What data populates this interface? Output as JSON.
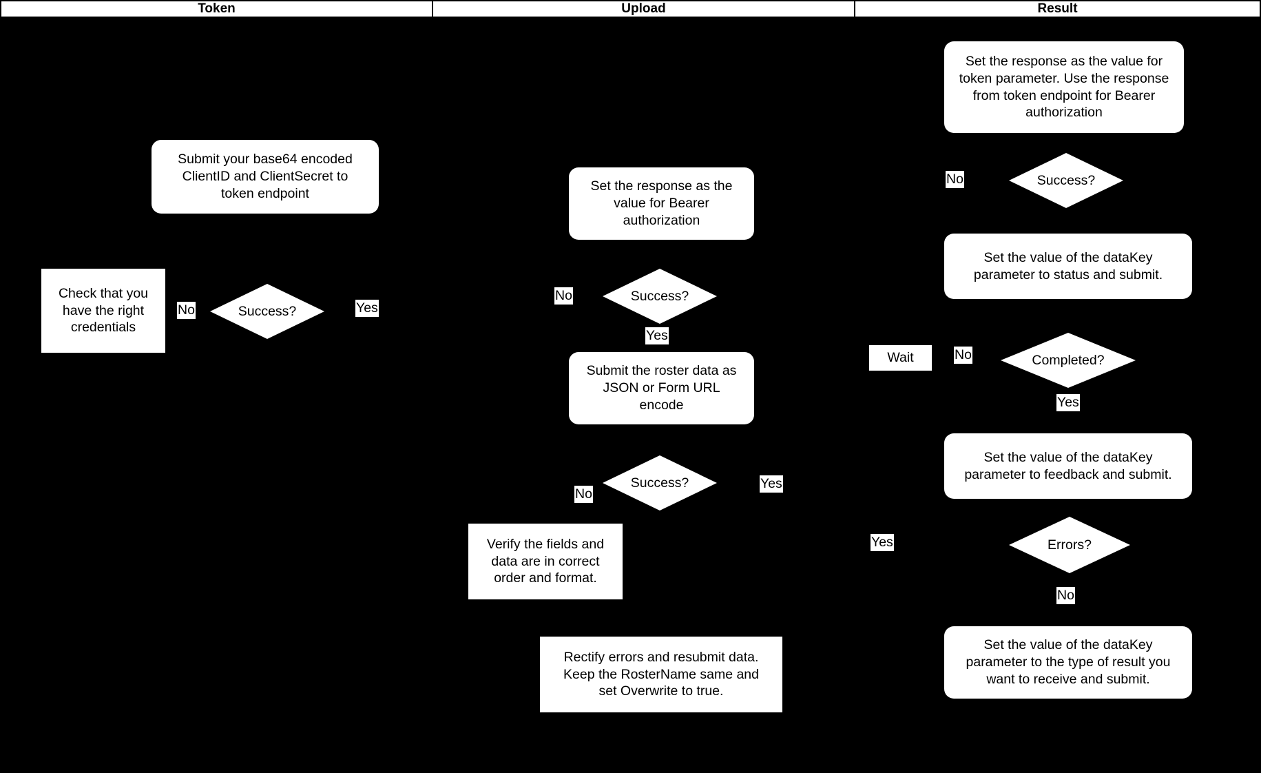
{
  "header": {
    "columns": [
      {
        "label": "Token"
      },
      {
        "label": "Upload"
      },
      {
        "label": "Result"
      }
    ]
  },
  "token_lane": {
    "nodes": [
      {
        "id": "submit-credentials",
        "shape": "rounded-rect",
        "text": "Submit your base64 encoded\nClientID and ClientSecret to\ntoken endpoint"
      },
      {
        "id": "check-credentials",
        "shape": "rect",
        "text": "Check that you\nhave the right\ncredentials"
      }
    ],
    "decisions": [
      {
        "id": "token-success",
        "text": "Success?"
      }
    ],
    "edge_labels": [
      {
        "id": "token-success-no",
        "text": "No"
      },
      {
        "id": "token-success-yes",
        "text": "Yes"
      }
    ]
  },
  "upload_lane": {
    "nodes": [
      {
        "id": "set-bearer-auth",
        "shape": "rounded-rect",
        "text": "Set the response as the\nvalue for Bearer\nauthorization"
      },
      {
        "id": "submit-roster-data",
        "shape": "rounded-rect",
        "text": "Submit the roster data as\nJSON or Form URL\nencode"
      },
      {
        "id": "verify-fields",
        "shape": "rect",
        "text": "Verify the fields and\ndata are in correct\norder and format."
      },
      {
        "id": "rectify-errors",
        "shape": "rect",
        "text": "Rectify errors and resubmit data.\nKeep the RosterName same and\nset Overwrite to true."
      }
    ],
    "decisions": [
      {
        "id": "upload-auth-success",
        "text": "Success?"
      },
      {
        "id": "upload-submit-success",
        "text": "Success?"
      }
    ],
    "edge_labels": [
      {
        "id": "upload-auth-success-no",
        "text": "No"
      },
      {
        "id": "upload-auth-success-yes",
        "text": "Yes"
      },
      {
        "id": "upload-submit-success-no",
        "text": "No"
      },
      {
        "id": "upload-submit-success-yes",
        "text": "Yes"
      }
    ]
  },
  "result_lane": {
    "nodes": [
      {
        "id": "set-token-parameter",
        "shape": "rounded-rect",
        "text": "Set the response as the value for\ntoken parameter. Use the response\nfrom token endpoint for Bearer\nauthorization"
      },
      {
        "id": "datakey-status",
        "shape": "rounded-rect",
        "text": "Set the value of the dataKey\nparameter to status and submit."
      },
      {
        "id": "datakey-feedback",
        "shape": "rounded-rect",
        "text": "Set the value of the dataKey\nparameter to feedback and submit."
      },
      {
        "id": "datakey-result-type",
        "shape": "rounded-rect",
        "text": "Set the value of the dataKey\nparameter to the type of result you\nwant to receive and submit."
      },
      {
        "id": "wait",
        "shape": "rect",
        "text": "Wait"
      }
    ],
    "decisions": [
      {
        "id": "result-success",
        "text": "Success?"
      },
      {
        "id": "result-completed",
        "text": "Completed?"
      },
      {
        "id": "result-errors",
        "text": "Errors?"
      }
    ],
    "edge_labels": [
      {
        "id": "result-success-no",
        "text": "No"
      },
      {
        "id": "result-completed-no",
        "text": "No"
      },
      {
        "id": "result-completed-yes",
        "text": "Yes"
      },
      {
        "id": "result-errors-yes",
        "text": "Yes"
      },
      {
        "id": "result-errors-no",
        "text": "No"
      }
    ]
  },
  "colors": {
    "background": "#000000",
    "node_fill": "#ffffff",
    "text": "#000000"
  }
}
